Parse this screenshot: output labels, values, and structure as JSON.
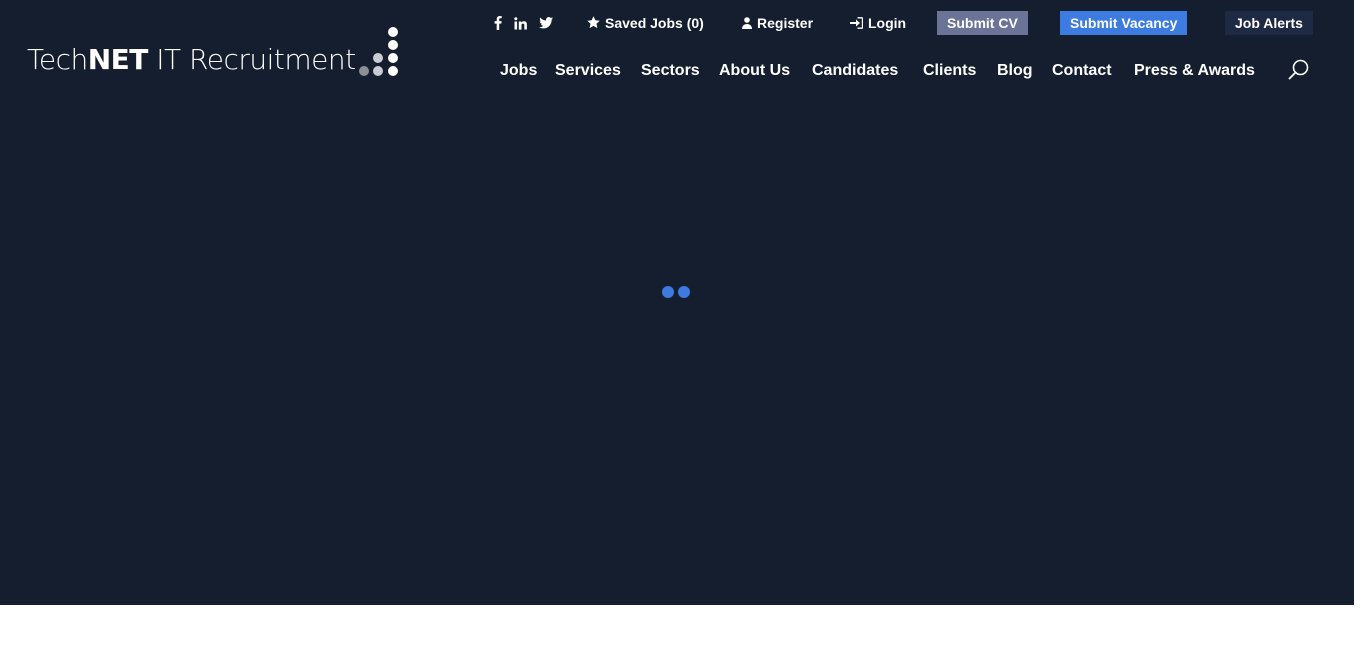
{
  "brand": {
    "logo_light": "Tech",
    "logo_bold": "NET",
    "logo_rest": " IT Recruitment"
  },
  "colors": {
    "background": "#141e2e",
    "submit_cv_bg": "#6b7396",
    "submit_vacancy_bg": "#3d7be0",
    "job_alerts_bg": "#1e2a44",
    "loader": "#3d7be0",
    "logo_dot_white": "#ffffff",
    "logo_dot_grey": "#8c8f96"
  },
  "social": {
    "facebook_icon": "facebook-icon",
    "linkedin_icon": "linkedin-icon",
    "twitter_icon": "twitter-icon"
  },
  "utility": {
    "saved_jobs": "Saved Jobs (0)",
    "register": "Register",
    "login": "Login",
    "submit_cv": "Submit CV",
    "submit_vacancy": "Submit Vacancy",
    "job_alerts": "Job Alerts"
  },
  "nav": [
    {
      "label": "Jobs"
    },
    {
      "label": "Services"
    },
    {
      "label": "Sectors"
    },
    {
      "label": "About Us"
    },
    {
      "label": "Candidates"
    },
    {
      "label": "Clients"
    },
    {
      "label": "Blog"
    },
    {
      "label": "Contact"
    },
    {
      "label": "Press & Awards"
    }
  ]
}
